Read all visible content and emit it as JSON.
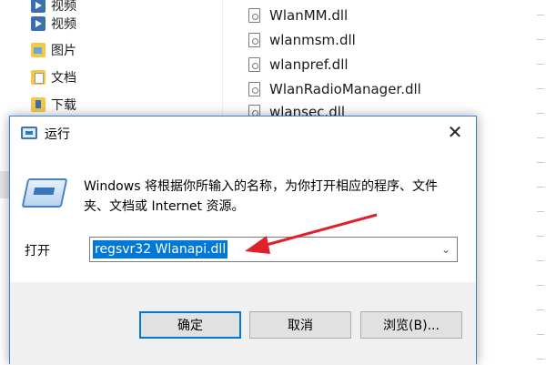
{
  "explorer": {
    "nav_items": [
      {
        "label": "视频",
        "icon": "video-icon"
      },
      {
        "label": "图片",
        "icon": "pictures-folder-icon"
      },
      {
        "label": "文档",
        "icon": "documents-folder-icon"
      },
      {
        "label": "下载",
        "icon": "downloads-folder-icon"
      }
    ],
    "files": [
      "WlanMM.dll",
      "wlanmsm.dll",
      "wlanpref.dll",
      "WlanRadioManager.dll",
      "wlansec.dll"
    ]
  },
  "run_dialog": {
    "title": "运行",
    "description": "Windows 将根据你所输入的名称，为你打开相应的程序、文件夹、文档或 Internet 资源。",
    "open_label": "打开",
    "command_value": "regsvr32 Wlanapi.dll",
    "buttons": {
      "ok": "确定",
      "cancel": "取消",
      "browse": "浏览(B)..."
    },
    "accent_color": "#0078d7",
    "annotation_color": "#e0202a"
  }
}
